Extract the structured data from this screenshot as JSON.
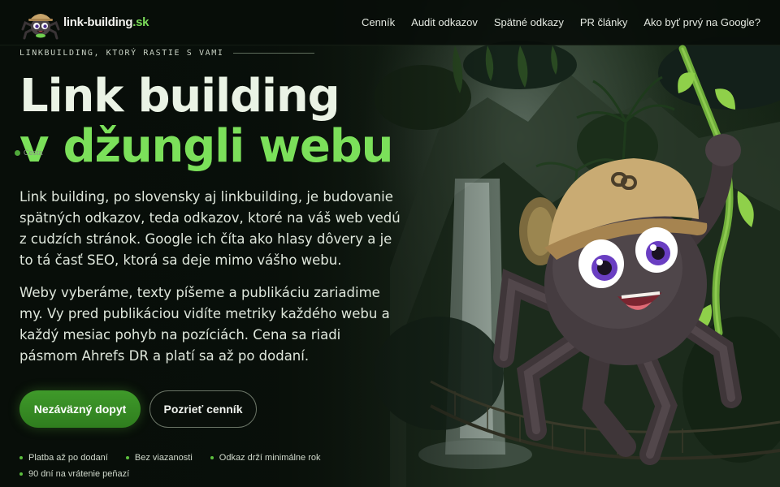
{
  "brand": {
    "name": "link-building",
    "tld": ".sk"
  },
  "nav": {
    "items": [
      {
        "label": "Cenník"
      },
      {
        "label": "Audit odkazov"
      },
      {
        "label": "Spätné odkazy"
      },
      {
        "label": "PR články"
      },
      {
        "label": "Ako byť prvý na Google?"
      }
    ]
  },
  "hero": {
    "eyebrow": "LINKBUILDING, KTORÝ RASTIE S VAMI",
    "title_line1": "Link building",
    "title_line2": "v džungli webu",
    "mini_tag": "Cesta",
    "paragraph1": "Link building, po slovensky aj linkbuilding, je budovanie spätných odkazov, teda odkazov, ktoré na váš web vedú z cudzích stránok. Google ich číta ako hlasy dôvery a je to tá časť SEO, ktorá sa deje mimo vášho webu.",
    "paragraph2": "Weby vyberáme, texty píšeme a publikáciu zariadime my. Vy pred publikáciou vidíte metriky každého webu a každý mesiac pohyb na pozíciách. Cena sa riadi pásmom Ahrefs DR a platí sa až po dodaní.",
    "cta_primary": "Nezáväzný dopyt",
    "cta_secondary": "Pozrieť cenník",
    "benefits": [
      "Platba až po dodaní",
      "Bez viazanosti",
      "Odkaz drží minimálne rok",
      "90 dní na vrátenie peňazí"
    ]
  },
  "theme": {
    "accent": "#7be05a",
    "button_green": "#3f9a2a",
    "background": "#0b120c"
  },
  "icons": {
    "logo": "spider-mascot-icon",
    "hero_illustration": "spider-explorer-on-vine",
    "cap_emblem": "chain-link-icon"
  }
}
